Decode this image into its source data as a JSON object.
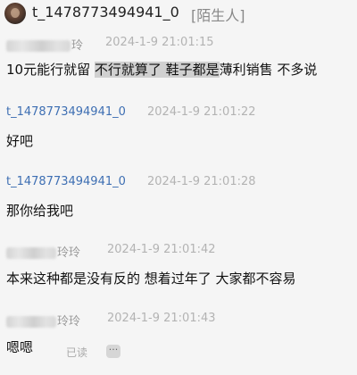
{
  "header": {
    "name": "t_1478773494941_0",
    "tag": "[陌生人]"
  },
  "messages": [
    {
      "sender_suffix": "玲",
      "time": "2024-1-9 21:01:15",
      "segments": [
        "10元能行就留 ",
        "不行就算了  鞋子都是",
        "薄利销售  不多说"
      ]
    },
    {
      "sender": "t_1478773494941_0",
      "time": "2024-1-9 21:01:22",
      "text": "好吧"
    },
    {
      "sender": "t_1478773494941_0",
      "time": "2024-1-9 21:01:28",
      "text": "那你给我吧"
    },
    {
      "sender_suffix": "玲玲",
      "time": "2024-1-9 21:01:42",
      "text": "本来这种都是没有反的  想着过年了 大家都不容易"
    },
    {
      "sender_suffix": "玲玲",
      "time": "2024-1-9 21:01:43",
      "text": "嗯嗯"
    }
  ],
  "read_status": "已读",
  "more_glyph": "···"
}
